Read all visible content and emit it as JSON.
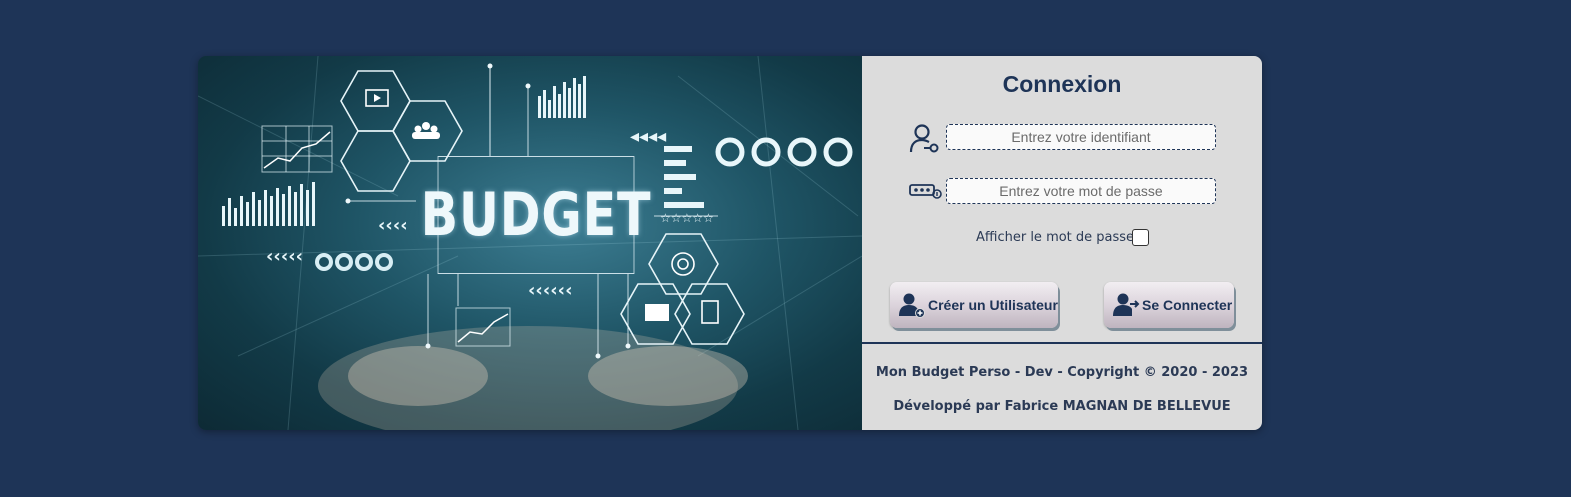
{
  "hero": {
    "title": "BUDGET"
  },
  "login": {
    "title": "Connexion",
    "username_placeholder": "Entrez votre identifiant",
    "password_placeholder": "Entrez votre mot de passe",
    "show_password_label": "Afficher le mot de passe",
    "show_password_checked": false,
    "create_user_label": "Créer un Utilisateur",
    "connect_label": "Se Connecter"
  },
  "footer": {
    "copyright": "Mon Budget Perso - Dev - Copyright © 2020 - 2023",
    "developer": "Développé par Fabrice MAGNAN DE BELLEVUE"
  },
  "icons": {
    "username": "user-key-icon",
    "password": "password-dots-icon",
    "create_user": "add-user-icon",
    "connect": "login-user-icon"
  },
  "colors": {
    "background": "#1e3457",
    "panel": "#dcdcdc",
    "accent": "#1e3457"
  }
}
